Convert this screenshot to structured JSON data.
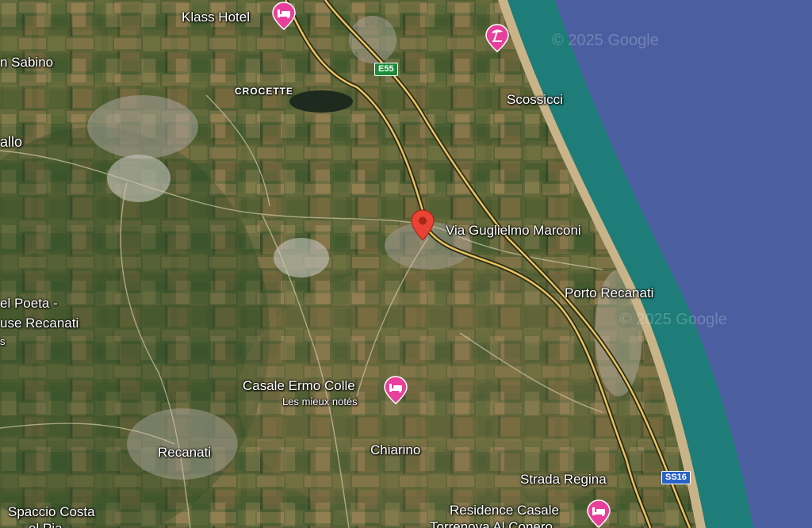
{
  "map": {
    "selected_place": {
      "label": "Via Guglielmo Marconi",
      "pin_color": "#ea4335"
    },
    "place_labels": [
      {
        "id": "klass-hotel",
        "text": "Klass Hotel"
      },
      {
        "id": "san-sabino",
        "text": "n Sabino"
      },
      {
        "id": "crocette",
        "text": "CROCETTE"
      },
      {
        "id": "scossicci",
        "text": "Scossicci"
      },
      {
        "id": "allo",
        "text": "allo"
      },
      {
        "id": "porto-recanati",
        "text": "Porto Recanati"
      },
      {
        "id": "poeta-1",
        "text": "el Poeta -"
      },
      {
        "id": "poeta-2",
        "text": "use Recanati"
      },
      {
        "id": "poeta-3",
        "text": "s"
      },
      {
        "id": "casale-ermo-colle",
        "text": "Casale Ermo Colle"
      },
      {
        "id": "casale-ermo-colle-sub",
        "text": "Les mieux notés"
      },
      {
        "id": "recanati",
        "text": "Recanati"
      },
      {
        "id": "chiarino",
        "text": "Chiarino"
      },
      {
        "id": "strada-regina",
        "text": "Strada Regina"
      },
      {
        "id": "spaccio-costa",
        "text": "Spaccio Costa"
      },
      {
        "id": "spaccio-costa-2",
        "text": "el Pia..."
      },
      {
        "id": "residence-casale",
        "text": "Residence Casale"
      },
      {
        "id": "residence-casale-2",
        "text": "Torrenova Al Conero"
      }
    ],
    "road_shields": [
      {
        "id": "e55",
        "text": "E55",
        "color": "#1e8a3a"
      },
      {
        "id": "ss16",
        "text": "SS16",
        "color": "#2b62c9"
      }
    ],
    "watermarks": [
      "© 2025 Google",
      "© 2025 Google"
    ],
    "poi_icons": [
      {
        "id": "klass-hotel",
        "icon": "bed-icon",
        "color": "#e8409a"
      },
      {
        "id": "beach",
        "icon": "beach-umbrella-icon",
        "color": "#e8409a"
      },
      {
        "id": "casale-ermo-colle",
        "icon": "bed-icon",
        "color": "#e8409a"
      },
      {
        "id": "residence-casale",
        "icon": "bed-icon",
        "color": "#e8409a"
      }
    ],
    "colors": {
      "sea": "#4b5ea0",
      "shallow_water": "#1e7d78",
      "beach": "#c9b48a",
      "road": "#e8c45a",
      "farmland": "#5a6b3a"
    }
  }
}
